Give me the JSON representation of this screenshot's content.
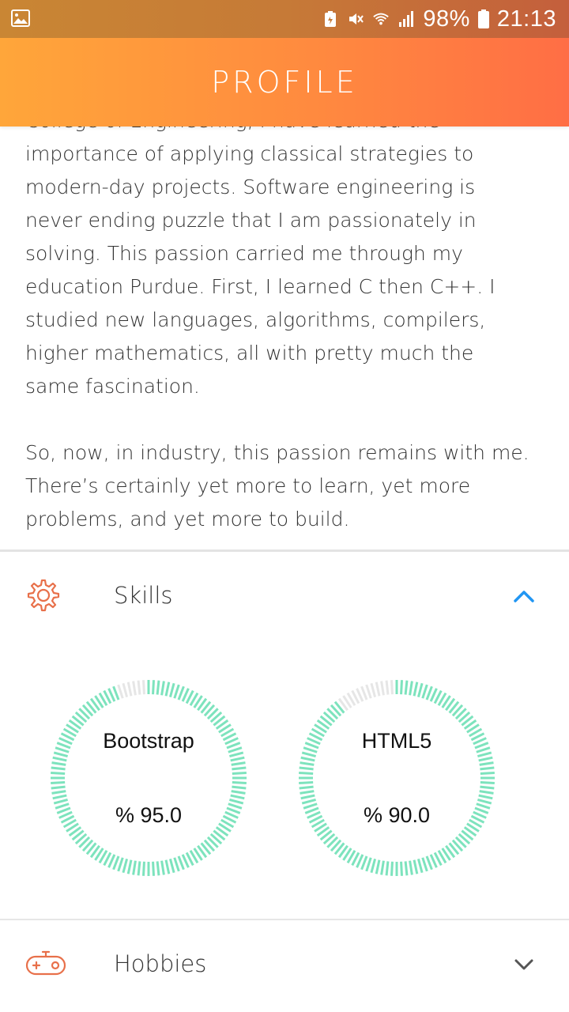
{
  "status_bar": {
    "battery": "98%",
    "time": "21:13",
    "icons": [
      "gallery-icon",
      "battery-saver-icon",
      "mute-icon",
      "wifi-icon",
      "signal-icon",
      "battery-icon"
    ]
  },
  "header": {
    "title": "PROFILE",
    "gradient": [
      "#ffa63a",
      "#ff6e45"
    ]
  },
  "bio": {
    "partial_line": "College of Engineering, I have learned the",
    "paragraph1": "importance of applying classical strategies to\nmodern-day projects. Software engineering is\nnever ending puzzle that I am passionately in\nsolving. This passion carried me through my\neducation Purdue. First, I learned C then C++. I\nstudied new languages, algorithms, compilers,\nhigher mathematics, all with pretty much the\nsame fascination.",
    "paragraph2": "So, now, in industry, this passion remains with me.\nThere’s certainly yet more to learn, yet more\nproblems, and yet more to build."
  },
  "skills": {
    "label": "Skills",
    "icon": "gear-icon",
    "expanded": true,
    "accent_color": "#e8704a",
    "chevron_color": "#2196f3",
    "gauge_color": "#7de3bd",
    "gauge_track_color": "#e6e6e6",
    "items": [
      {
        "name": "Bootstrap",
        "value_label": "% 95.0",
        "fraction": 0.95
      },
      {
        "name": "HTML5",
        "value_label": "% 90.0",
        "fraction": 0.9
      }
    ]
  },
  "hobbies": {
    "label": "Hobbies",
    "icon": "gamepad-icon",
    "expanded": false
  }
}
